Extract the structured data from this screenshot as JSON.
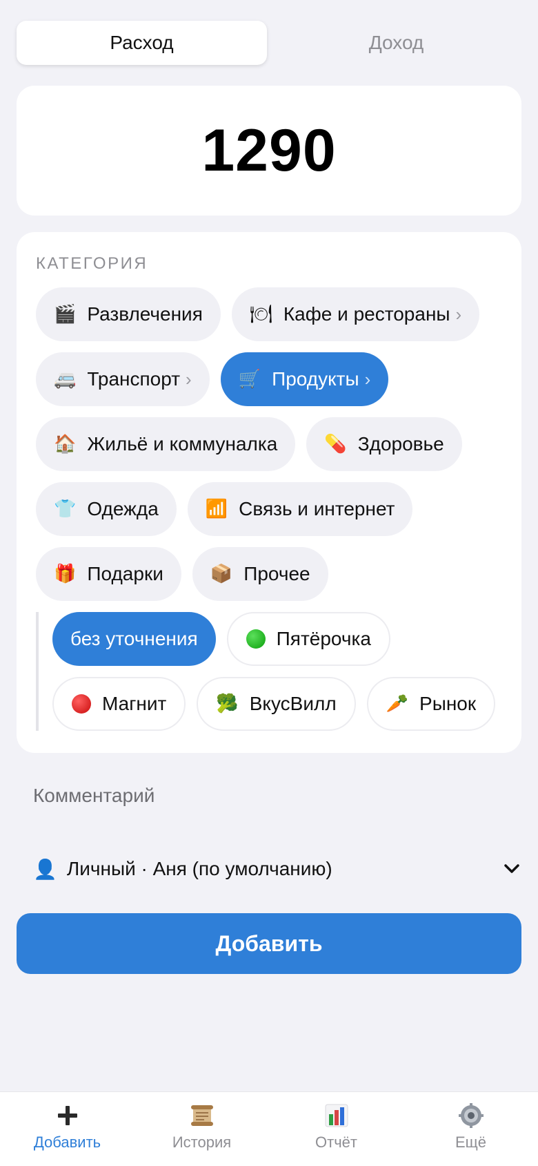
{
  "type_switch": {
    "expense": "Расход",
    "income": "Доход"
  },
  "amount": "1290",
  "category": {
    "title": "КАТЕГОРИЯ",
    "rows": [
      [
        {
          "icon": "🎬",
          "label": "Развлечения",
          "chevron": ""
        },
        {
          "icon": "🍽",
          "label": "Кафе и рестораны",
          "chevron": "›"
        }
      ],
      [
        {
          "icon": "🚐",
          "label": "Транспорт",
          "chevron": "›"
        },
        {
          "icon": "🛒",
          "label": "Продукты",
          "chevron": "›"
        }
      ],
      [
        {
          "icon": "🏠",
          "label": "Жильё и коммуналка",
          "chevron": ""
        },
        {
          "icon": "💊",
          "label": "Здоровье",
          "chevron": ""
        }
      ],
      [
        {
          "icon": "👕",
          "label": "Одежда",
          "chevron": ""
        },
        {
          "icon": "📶",
          "label": "Связь и интернет",
          "chevron": ""
        }
      ],
      [
        {
          "icon": "🎁",
          "label": "Подарки",
          "chevron": ""
        },
        {
          "icon": "📦",
          "label": "Прочее",
          "chevron": ""
        }
      ]
    ],
    "selected": "Продукты",
    "subcategories": {
      "none": "без уточнения",
      "pyaterochka": {
        "label": "Пятёрочка",
        "icon": "green-circle-icon"
      },
      "magnit": {
        "label": "Магнит",
        "icon": "red-circle-icon"
      },
      "vkusvill": {
        "icon": "🥦",
        "label": "ВкусВилл"
      },
      "rynok": {
        "icon": "🥕",
        "label": "Рынок"
      }
    }
  },
  "comment_placeholder": "Комментарий",
  "account": {
    "icon": "👤",
    "label": "Личный · Аня (по умолчанию)"
  },
  "add_button": "Добавить",
  "tabs": {
    "add": "Добавить",
    "history": "История",
    "report": "Отчёт",
    "more": "Ещё"
  },
  "colors": {
    "accent": "#2f7fd8",
    "background": "#f2f2f7"
  }
}
